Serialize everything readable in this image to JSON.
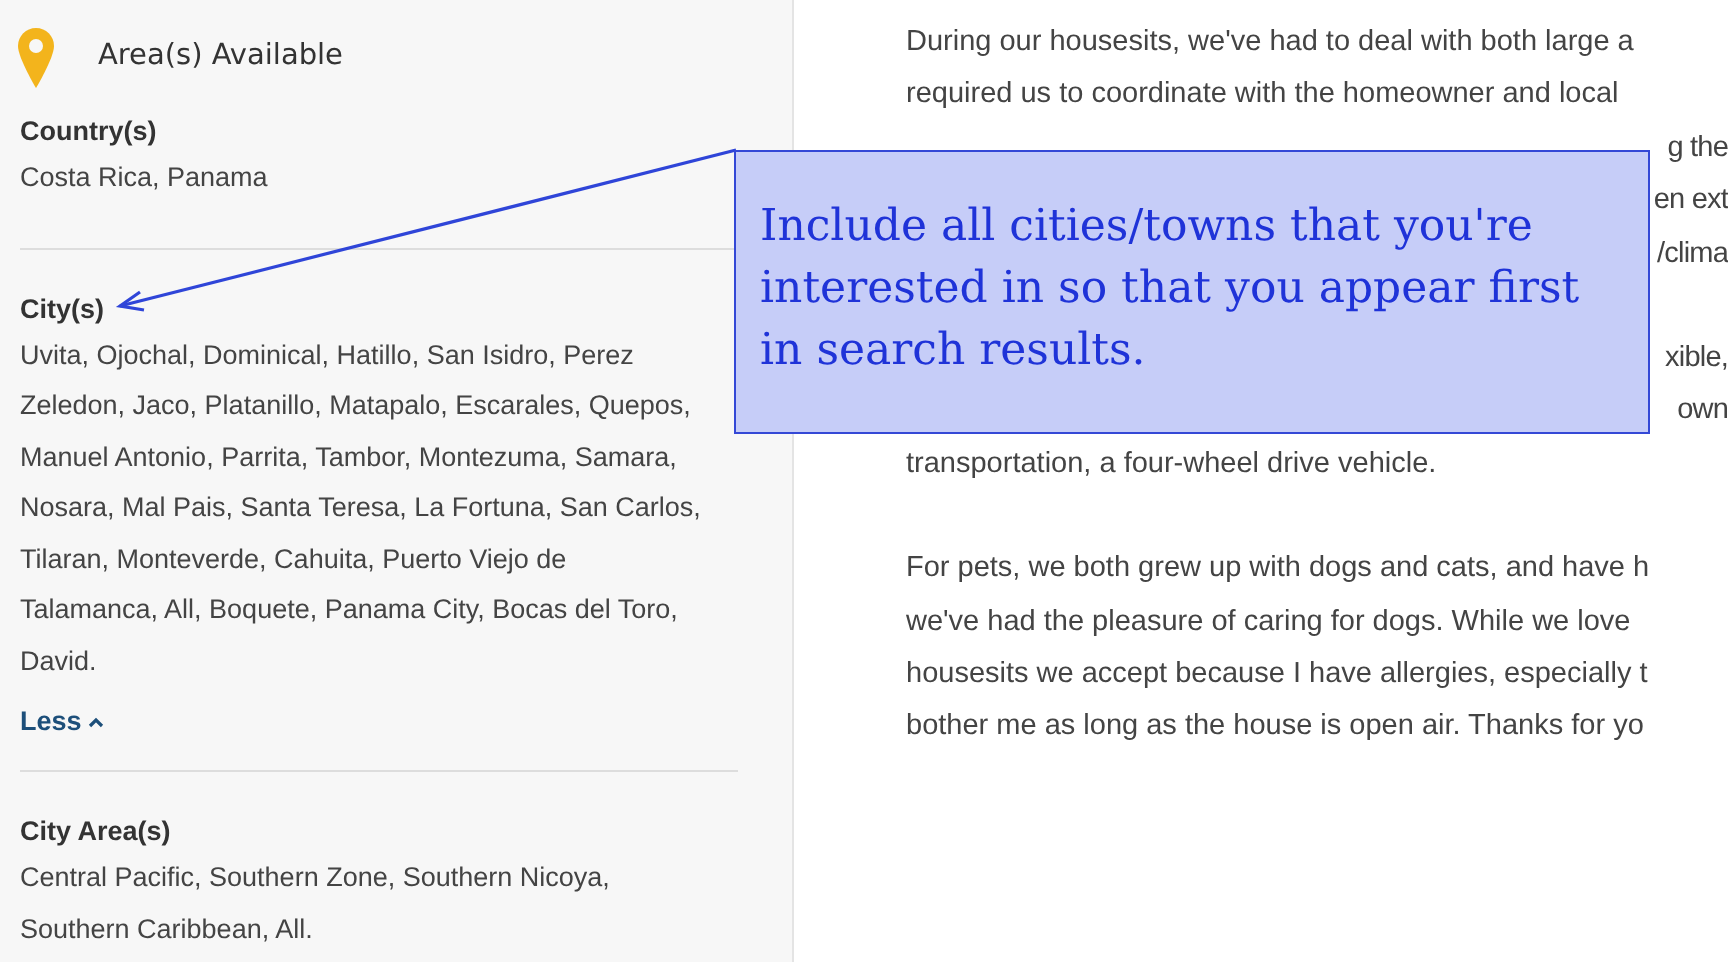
{
  "sidebar": {
    "title": "Area(s) Available",
    "sections": [
      {
        "heading": "Country(s)",
        "text": "Costa Rica, Panama"
      },
      {
        "heading": "City(s)",
        "text": "Uvita, Ojochal, Dominical, Hatillo, San Isidro, Perez Zeledon, Jaco, Platanillo, Matapalo, Escarales, Quepos, Manuel Antonio, Parrita, Tambor, Montezuma, Samara, Nosara, Mal Pais, Santa Teresa, La Fortuna, San Carlos, Tilaran, Monteverde, Cahuita, Puerto Viejo de Talamanca, All, Boquete, Panama City, Bocas del Toro, David.",
        "toggle": {
          "label": "Less",
          "expanded": true
        }
      },
      {
        "heading": "City Area(s)",
        "text": "Central Pacific, Southern Zone, Southern Nicoya, Southern Caribbean, All."
      }
    ]
  },
  "content": {
    "paragraphs": [
      {
        "lines": [
          {
            "kind": "full",
            "text": "During our housesits, we've had to deal with both large a"
          },
          {
            "kind": "full",
            "text": "required us to coordinate with the homeowner and local"
          },
          {
            "kind": "covered",
            "text": "g the"
          },
          {
            "kind": "covered",
            "text": "en ext"
          },
          {
            "kind": "covered",
            "text": "/clima"
          }
        ]
      },
      {
        "lines": [
          {
            "kind": "covered",
            "text": "xible,"
          },
          {
            "kind": "covered",
            "text": "own"
          },
          {
            "kind": "full",
            "text": "transportation, a four-wheel drive vehicle."
          }
        ]
      },
      {
        "lines": [
          {
            "kind": "full",
            "text": "For pets, we both grew up with dogs and cats, and have h"
          },
          {
            "kind": "full",
            "text": "we've had the pleasure of caring for dogs. While we love"
          },
          {
            "kind": "full",
            "text": "housesits we accept because I have allergies, especially t"
          },
          {
            "kind": "full",
            "text": "bother me as long as the house is open air. Thanks for yo"
          }
        ]
      }
    ]
  },
  "callout": {
    "text": "Include all cities/towns that you're interested in so that you appear first in search results."
  }
}
